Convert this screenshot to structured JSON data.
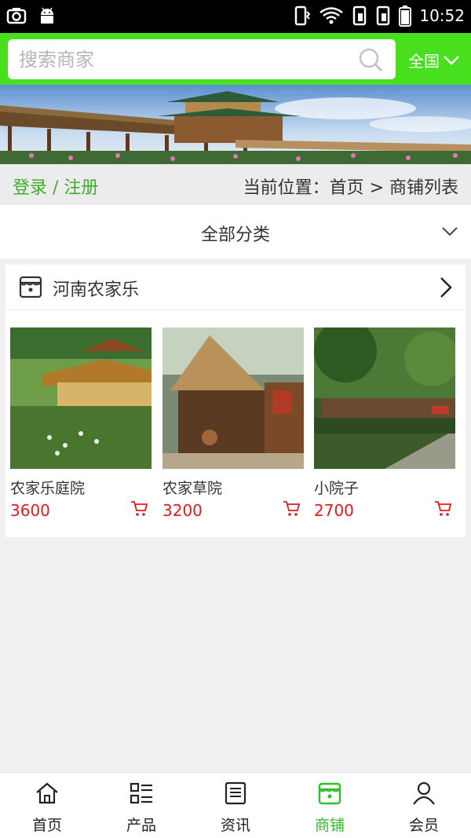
{
  "status_bar": {
    "time": "10:52"
  },
  "search": {
    "placeholder": "搜索商家",
    "region": "全国"
  },
  "location_bar": {
    "login": "登录 / 注册",
    "breadcrumb": "当前位置：首页 > 商铺列表"
  },
  "category": {
    "label": "全部分类"
  },
  "shop": {
    "name": "河南农家乐",
    "products": [
      {
        "name": "农家乐庭院",
        "price": "3600"
      },
      {
        "name": "农家草院",
        "price": "3200"
      },
      {
        "name": "小院子",
        "price": "2700"
      }
    ]
  },
  "bottom_nav": {
    "items": [
      {
        "label": "首页",
        "icon": "home-icon"
      },
      {
        "label": "产品",
        "icon": "product-list-icon"
      },
      {
        "label": "资讯",
        "icon": "news-icon"
      },
      {
        "label": "商铺",
        "icon": "shop-icon"
      },
      {
        "label": "会员",
        "icon": "member-icon"
      }
    ],
    "active_index": 3
  },
  "colors": {
    "brand_green": "#48e01e",
    "price_red": "#e01b1b",
    "active_nav": "#2fbf2a",
    "login_green": "#3fae2a"
  }
}
